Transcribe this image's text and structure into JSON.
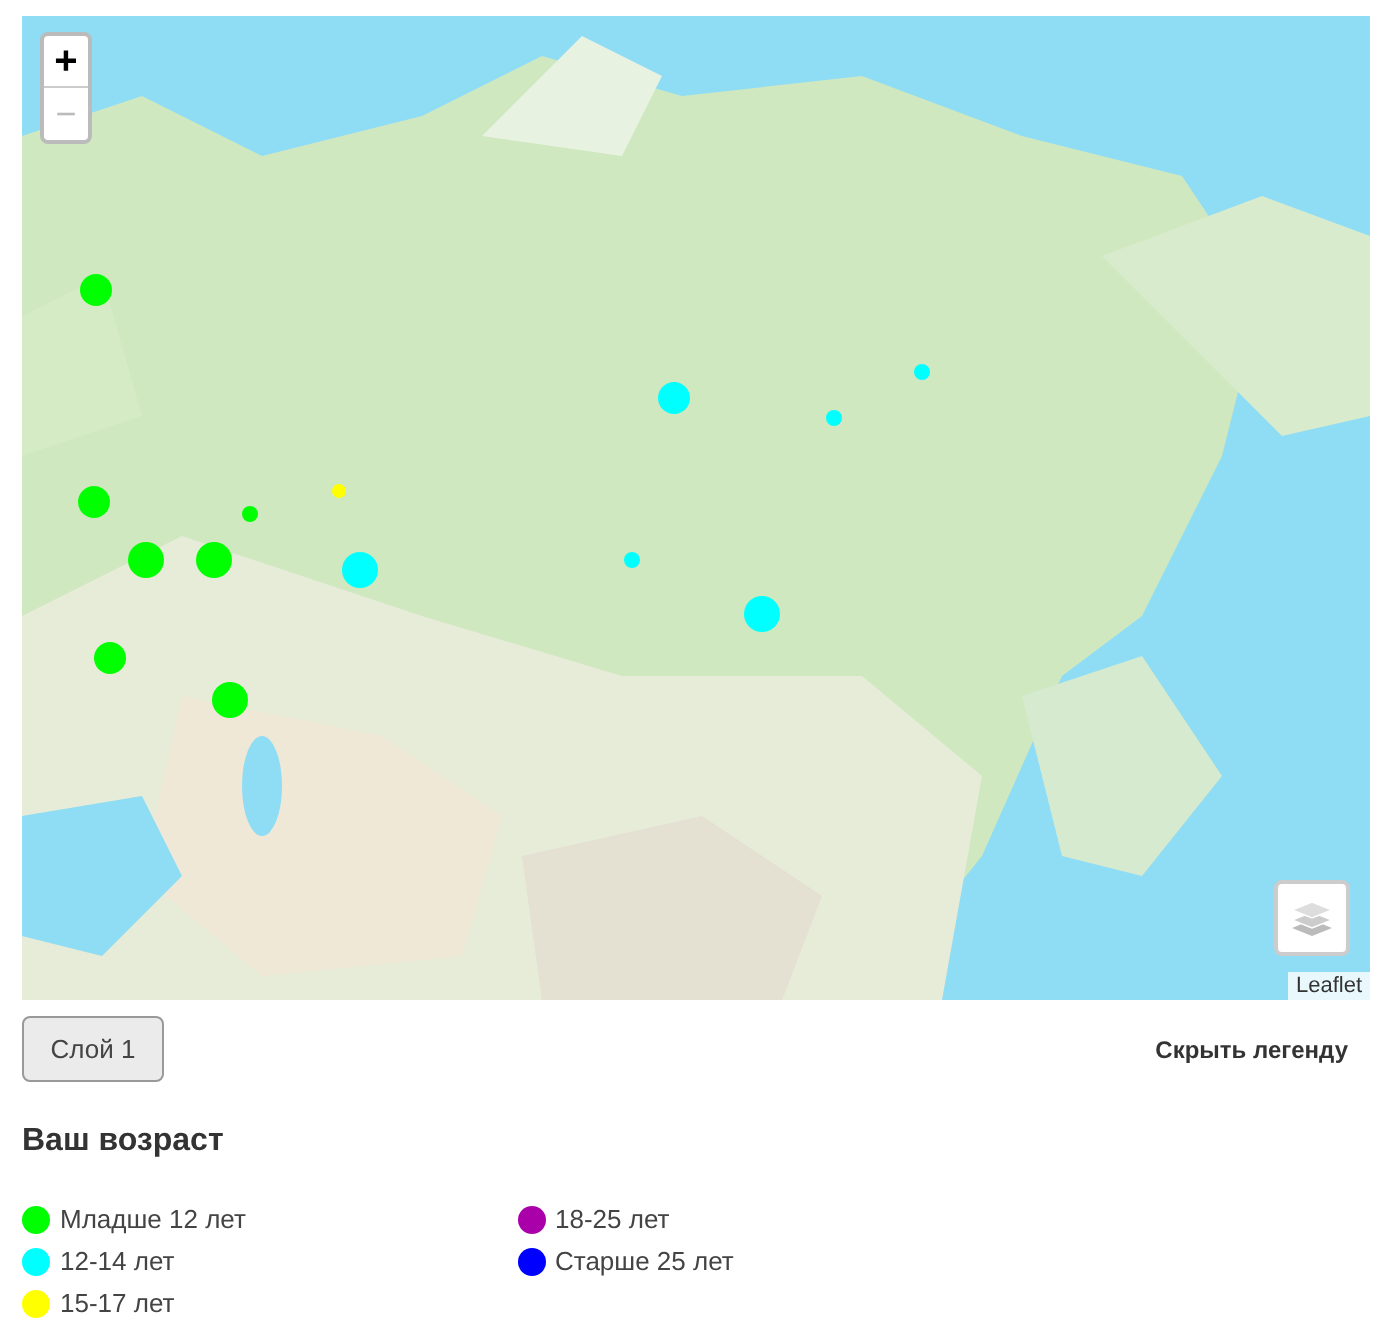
{
  "map": {
    "zoom_in": "+",
    "zoom_out": "−",
    "attribution": "Leaflet",
    "markers": [
      {
        "color": "#00ff00"
      },
      {
        "color": "#00ff00"
      },
      {
        "color": "#00ff00"
      },
      {
        "color": "#00ff00"
      },
      {
        "color": "#00ff00"
      },
      {
        "color": "#00ff00"
      },
      {
        "color": "#00ff00"
      },
      {
        "color": "#ffff00"
      },
      {
        "color": "#00ffff"
      },
      {
        "color": "#00ffff"
      },
      {
        "color": "#00ffff"
      },
      {
        "color": "#00ffff"
      },
      {
        "color": "#00ffff"
      },
      {
        "color": "#00ffff"
      }
    ]
  },
  "layer_button": "Слой 1",
  "hide_legend": "Скрыть легенду",
  "legend": {
    "title": "Ваш возраст",
    "items": [
      {
        "label": "Младше 12 лет",
        "color": "#00ff00"
      },
      {
        "label": "12-14 лет",
        "color": "#00ffff"
      },
      {
        "label": "15-17 лет",
        "color": "#ffff00"
      },
      {
        "label": "18-25 лет",
        "color": "#aa00aa"
      },
      {
        "label": "Старше 25 лет",
        "color": "#0000ff"
      }
    ]
  }
}
